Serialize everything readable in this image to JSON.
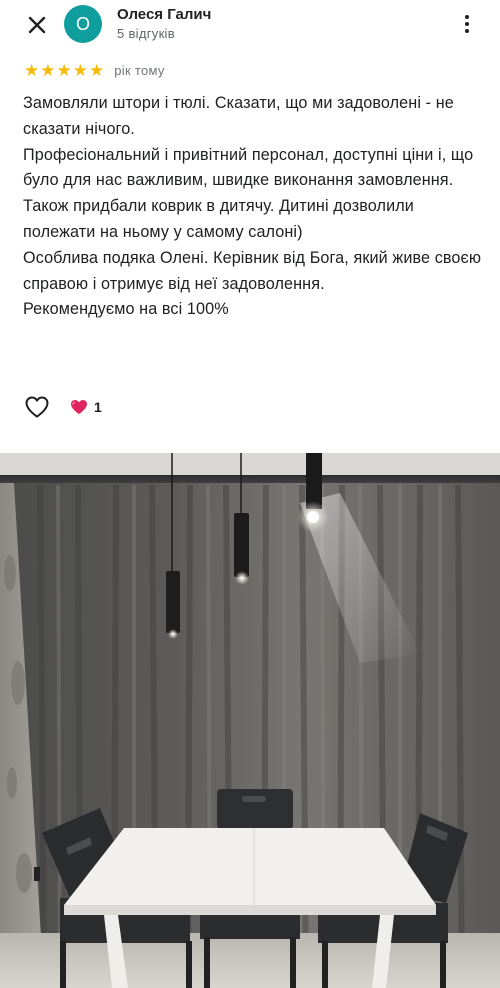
{
  "header": {
    "author_name": "Олеся Галич",
    "avatar_letter": "О",
    "reviews_count": "5 відгуків"
  },
  "rating": {
    "stars": 5,
    "time_ago": "рік тому"
  },
  "review": {
    "text": "Замовляли штори і тюлі. Сказати, що ми задоволені - не сказати нічого.\nПрофесіональний і привітний персонал, доступні ціни і, що було для нас важливим, швидке виконання замовлення.\nТакож придбали коврик в дитячу.  Дитині дозволили полежати на ньому у самому салоні)\nОсоблива подяка Олені. Керівник від Бога, який живе своєю справою і отримує від неї задоволення.\nРекомендуємо на всі 100%"
  },
  "actions": {
    "reaction_count": "1"
  },
  "colors": {
    "avatar": "#0f9d9d",
    "star": "#f6bb06",
    "heart_reaction": "#e0245e"
  },
  "icons": [
    "close-icon",
    "more-vert-icon",
    "star-icon",
    "heart-outline-icon",
    "heart-filled-icon"
  ]
}
